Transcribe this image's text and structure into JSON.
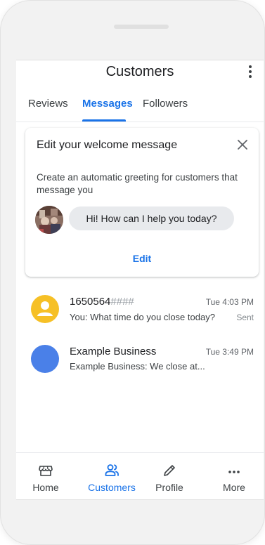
{
  "app": {
    "title": "Customers"
  },
  "tabs": [
    {
      "label": "Reviews"
    },
    {
      "label": "Messages"
    },
    {
      "label": "Followers"
    }
  ],
  "active_tab": "Messages",
  "welcome_card": {
    "title": "Edit your welcome message",
    "description": "Create an automatic greeting for customers that message you",
    "greeting": "Hi! How can I help you today?",
    "edit_label": "Edit"
  },
  "conversations": [
    {
      "name": "1650564",
      "name_masked": "####",
      "snippet": "You: What time do you close today?",
      "time": "Tue 4:03 PM",
      "status": "Sent",
      "avatar_color": "#f6c026"
    },
    {
      "name": "Example Business",
      "snippet": "Example Business: We close at...",
      "time": "Tue 3:49 PM",
      "avatar_color": "#4a80e8"
    }
  ],
  "bottom_nav": [
    {
      "label": "Home",
      "icon": "storefront-icon"
    },
    {
      "label": "Customers",
      "icon": "customers-icon"
    },
    {
      "label": "Profile",
      "icon": "pencil-icon"
    },
    {
      "label": "More",
      "icon": "more-horizontal-icon"
    }
  ],
  "colors": {
    "accent": "#1a73e8",
    "bubble": "#e8eaed"
  }
}
